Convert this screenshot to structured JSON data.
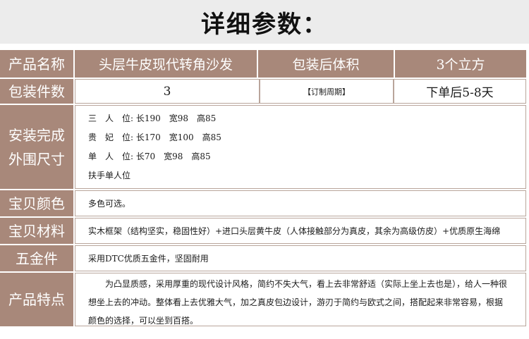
{
  "header": {
    "title": "详细参数："
  },
  "row1": {
    "label": "产品名称",
    "name": "头层牛皮现代转角沙发",
    "volume_label": "包装后体积",
    "volume": "3个立方"
  },
  "row2": {
    "label": "包装件数",
    "count": "3",
    "cycle_label": "【订制周期】",
    "cycle": "下单后5-8天"
  },
  "row3": {
    "label_line1": "安装完成",
    "label_line2": "外围尺寸",
    "dims": [
      "三　人　位: 长190　宽98　高85",
      "贵　妃　位: 长170　宽100　高85",
      "单　人　位: 长70　宽98　高85",
      "扶手单人位"
    ]
  },
  "row4": {
    "label": "宝贝颜色",
    "value": "多色可选。"
  },
  "row5": {
    "label": "宝贝材料",
    "value": "实木框架（结构坚实，稳固性好）+进口头层黄牛皮（人体接触部分为真皮，其余为高级仿皮）+优质原生海绵"
  },
  "row6": {
    "label": "五金件",
    "value": "采用DTC优质五金件，坚固耐用"
  },
  "row7": {
    "label": "产品特点",
    "value": "为凸显质感，采用厚重的现代设计风格，简约不失大气，看上去非常舒适（实际上坐上去也是），给人一种很想坐上去的冲动。整体看上去优雅大气，加之真皮包边设计，游刃于简约与欧式之间，搭配起来非常容易，根据颜色的选择，可以坐到百搭。"
  }
}
